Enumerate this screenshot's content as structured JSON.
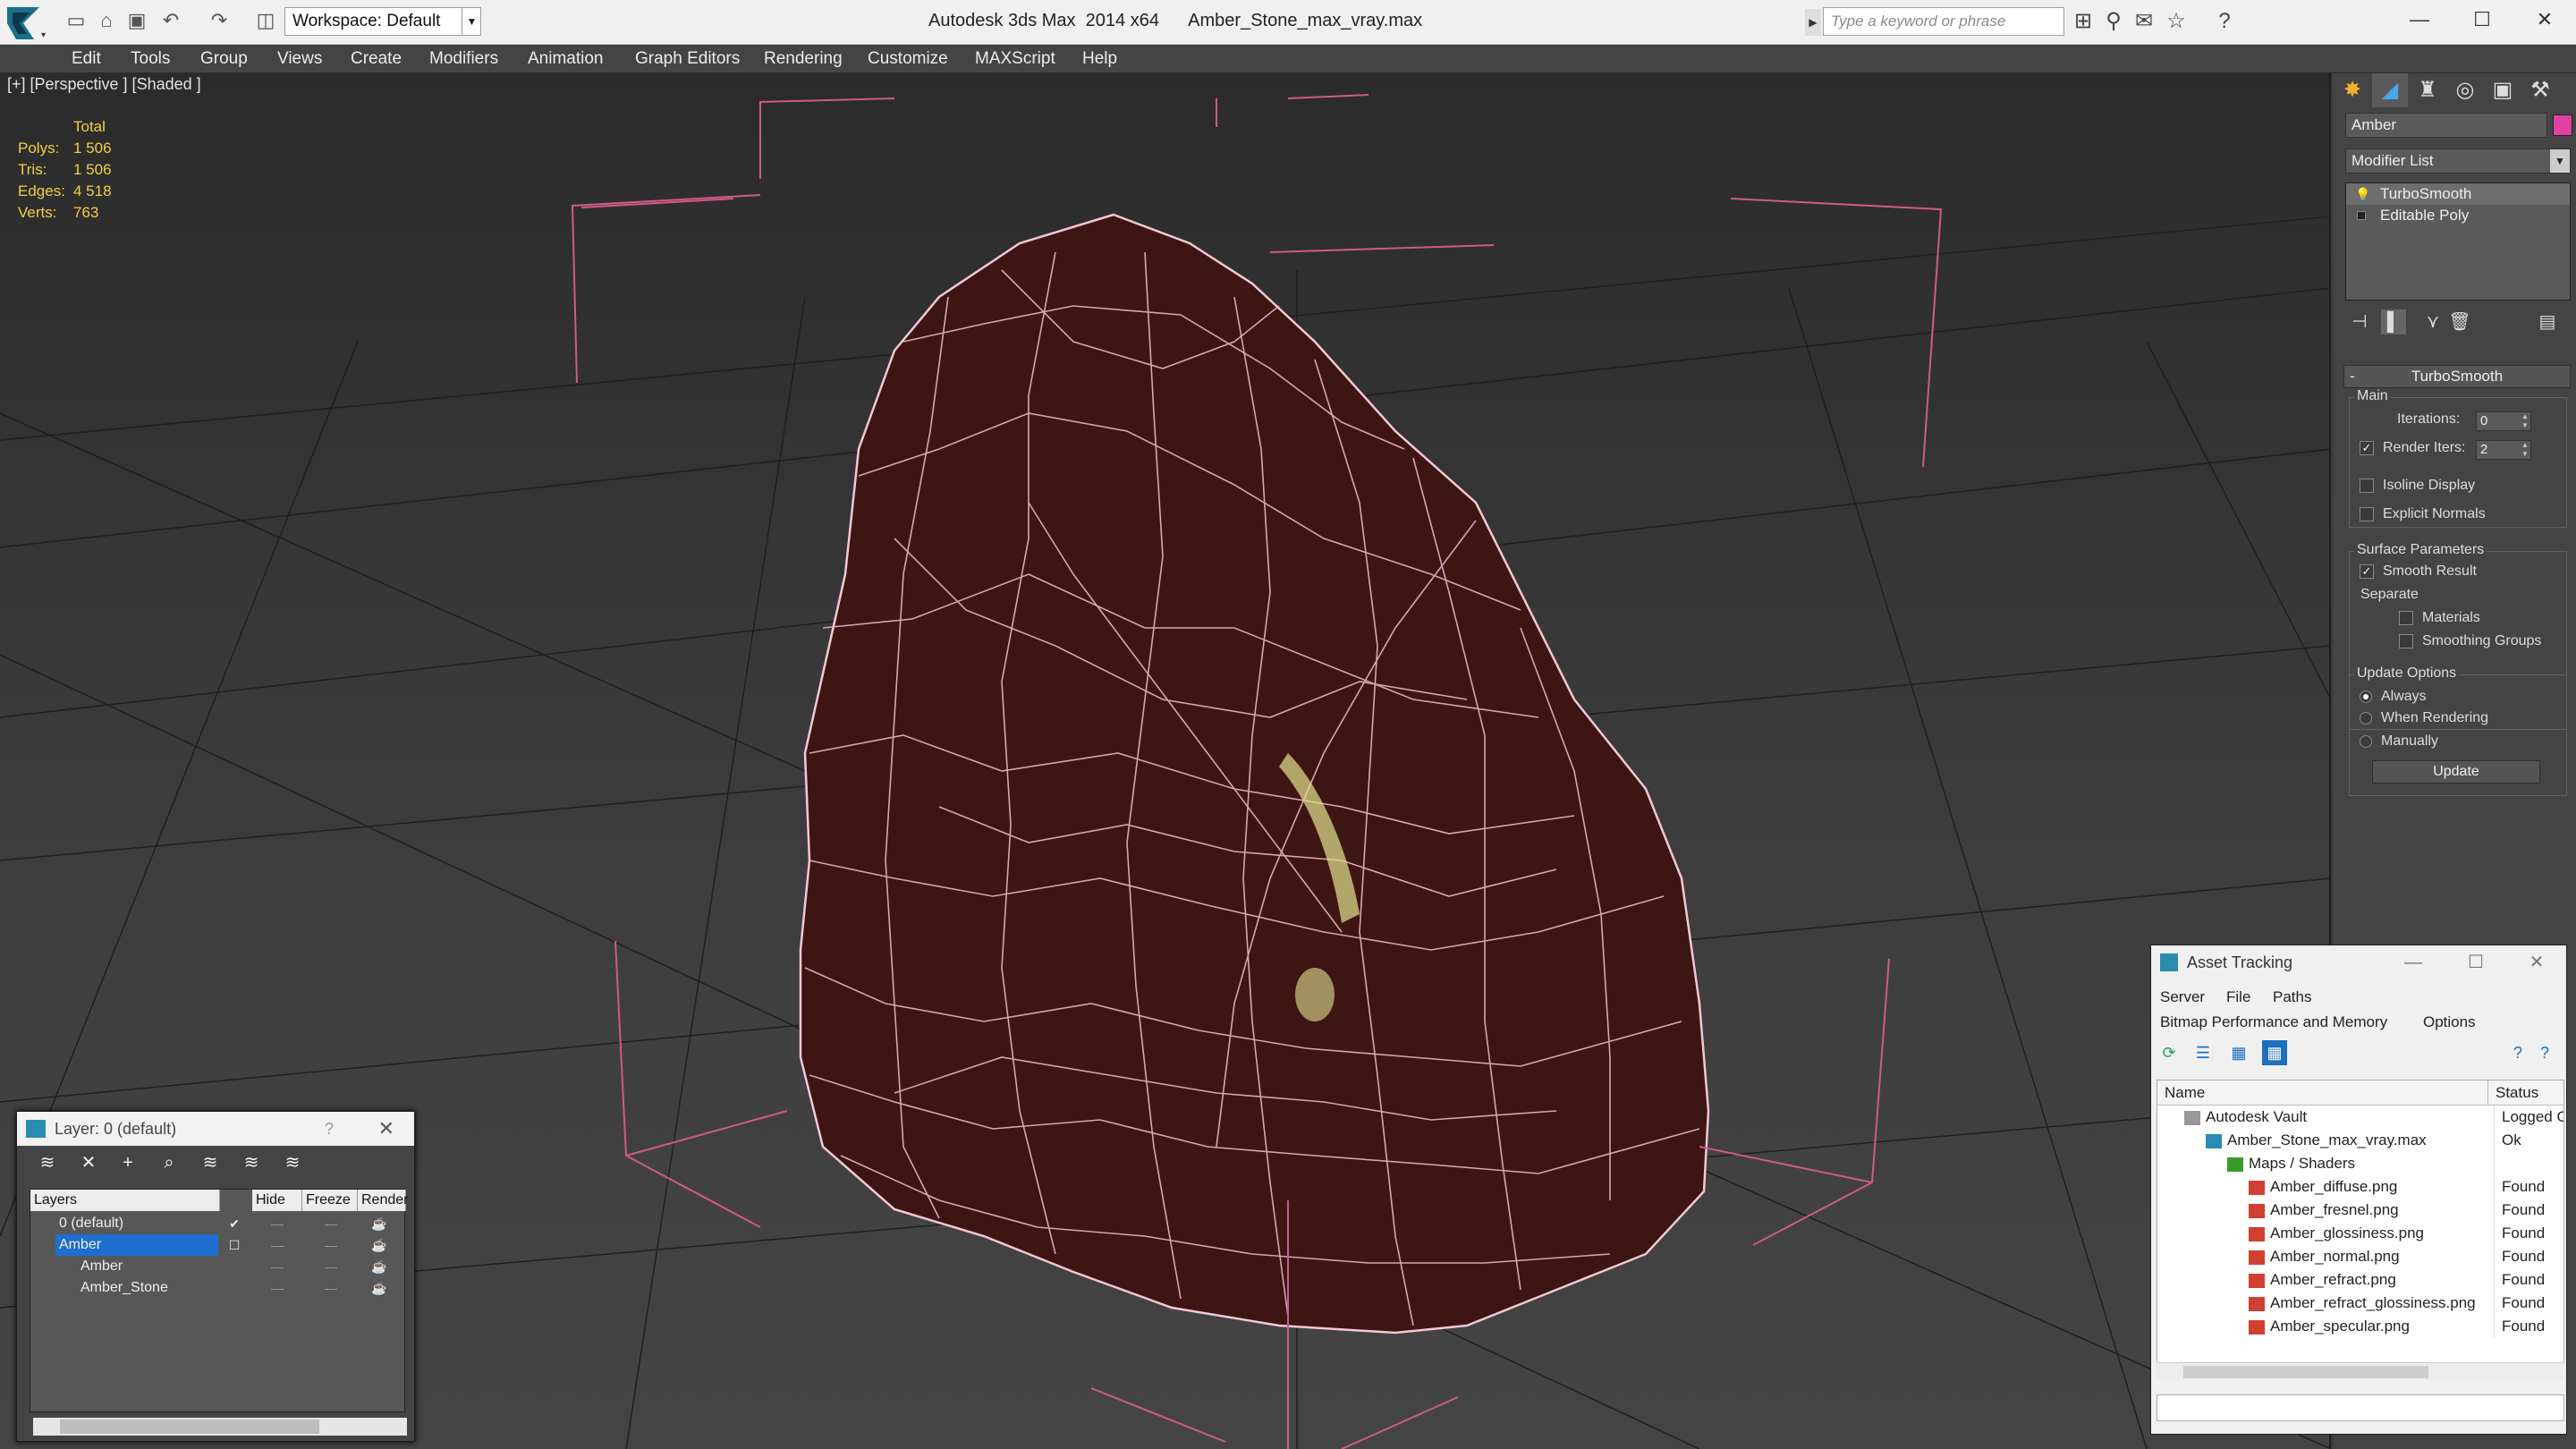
{
  "titlebar": {
    "workspace_label": "Workspace: Default",
    "title": "Autodesk 3ds Max  2014 x64      Amber_Stone_max_vray.max",
    "search_placeholder": "Type a keyword or phrase"
  },
  "menu": [
    "Edit",
    "Tools",
    "Group",
    "Views",
    "Create",
    "Modifiers",
    "Animation",
    "Graph Editors",
    "Rendering",
    "Customize",
    "MAXScript",
    "Help"
  ],
  "viewport": {
    "label": "[+] [Perspective ] [Shaded ]",
    "stats": {
      "header": "Total",
      "rows": [
        {
          "label": "Polys:",
          "value": "1 506"
        },
        {
          "label": "Tris:",
          "value": "1 506"
        },
        {
          "label": "Edges:",
          "value": "4 518"
        },
        {
          "label": "Verts:",
          "value": "763"
        }
      ]
    }
  },
  "command_panel": {
    "object_name": "Amber",
    "object_color": "#e040a0",
    "modifier_list": "Modifier List",
    "stack": [
      "TurboSmooth",
      "Editable Poly"
    ],
    "rollout_title": "TurboSmooth",
    "main_group": "Main",
    "iterations_label": "Iterations:",
    "iterations_value": "0",
    "render_iters_label": "Render Iters:",
    "render_iters_value": "2",
    "isoline_label": "Isoline Display",
    "explicit_label": "Explicit Normals",
    "surface_group": "Surface Parameters",
    "smooth_result_label": "Smooth Result",
    "separate_label": "Separate",
    "materials_label": "Materials",
    "smoothing_groups_label": "Smoothing Groups",
    "update_group": "Update Options",
    "always_label": "Always",
    "when_rendering_label": "When Rendering",
    "manually_label": "Manually",
    "update_button": "Update"
  },
  "layer_dialog": {
    "title": "Layer: 0 (default)",
    "help": "?",
    "headers": [
      "Layers",
      "Hide",
      "Freeze",
      "Render"
    ],
    "rows": [
      {
        "name": "0 (default)",
        "indent": 0
      },
      {
        "name": "Amber",
        "indent": 0
      },
      {
        "name": "Amber",
        "indent": 1
      },
      {
        "name": "Amber_Stone",
        "indent": 1
      }
    ]
  },
  "asset_tracking": {
    "title": "Asset Tracking",
    "menu_row1": [
      "Server",
      "File",
      "Paths"
    ],
    "menu_row2": [
      "Bitmap Performance and Memory",
      "Options"
    ],
    "headers": [
      "Name",
      "Status"
    ],
    "rows": [
      {
        "name": "Autodesk Vault",
        "status": "Logged O",
        "indent": 1,
        "icon": "vault"
      },
      {
        "name": "Amber_Stone_max_vray.max",
        "status": "Ok",
        "indent": 2,
        "icon": "max"
      },
      {
        "name": "Maps / Shaders",
        "status": "",
        "indent": 3,
        "icon": "maps"
      },
      {
        "name": "Amber_diffuse.png",
        "status": "Found",
        "indent": 4,
        "icon": "png"
      },
      {
        "name": "Amber_fresnel.png",
        "status": "Found",
        "indent": 4,
        "icon": "png"
      },
      {
        "name": "Amber_glossiness.png",
        "status": "Found",
        "indent": 4,
        "icon": "png"
      },
      {
        "name": "Amber_normal.png",
        "status": "Found",
        "indent": 4,
        "icon": "png"
      },
      {
        "name": "Amber_refract.png",
        "status": "Found",
        "indent": 4,
        "icon": "png"
      },
      {
        "name": "Amber_refract_glossiness.png",
        "status": "Found",
        "indent": 4,
        "icon": "png"
      },
      {
        "name": "Amber_specular.png",
        "status": "Found",
        "indent": 4,
        "icon": "png"
      }
    ]
  }
}
